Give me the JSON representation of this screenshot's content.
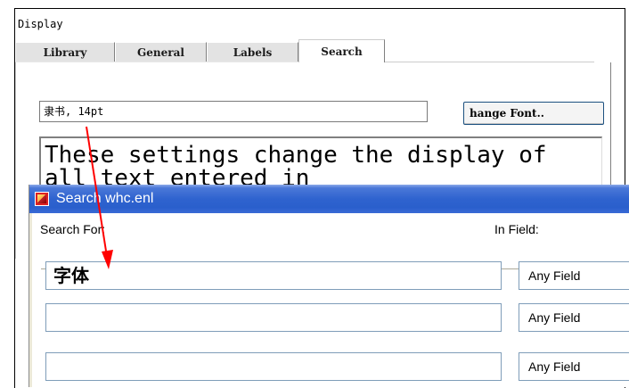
{
  "panel": {
    "title": "Display"
  },
  "tabs": [
    {
      "label": "Library"
    },
    {
      "label": "General"
    },
    {
      "label": "Labels"
    },
    {
      "label": "Search"
    }
  ],
  "font_setting": {
    "value": "隶书, 14pt",
    "change_button_label": "hange Font.."
  },
  "sample_text": "These settings change the display of all text entered in",
  "search_window": {
    "title": "Search whc.enl",
    "search_for_label": "Search For:",
    "in_field_label": "In Field:",
    "rows": [
      {
        "value": "字体",
        "field": "Any Field"
      },
      {
        "value": "",
        "field": "Any Field"
      },
      {
        "value": "",
        "field": "Any Field"
      }
    ]
  },
  "colors": {
    "annotation_arrow": "#ff0000",
    "titlebar": "#2f63cf"
  },
  "icons": [
    "app-icon"
  ]
}
